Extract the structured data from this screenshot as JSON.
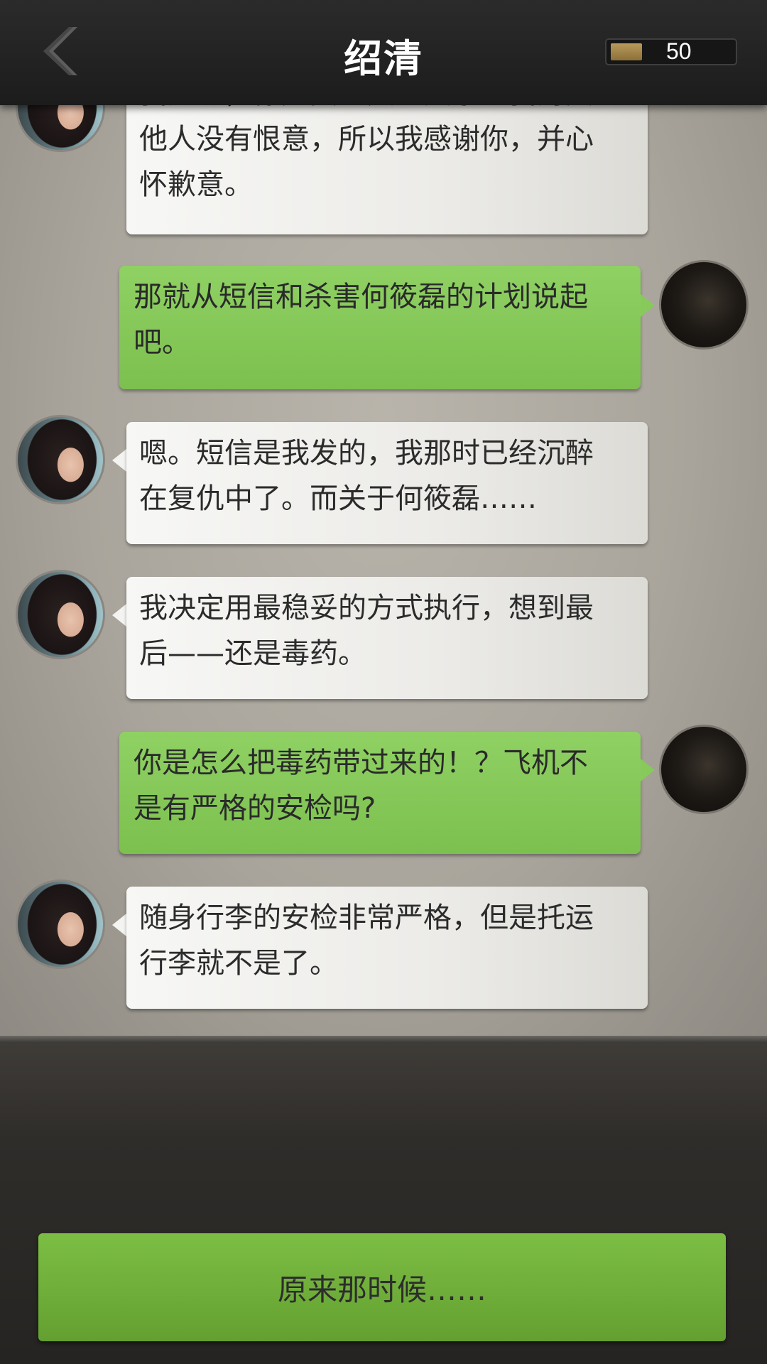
{
  "header": {
    "title": "绍清",
    "coin_count": "50"
  },
  "messages": [
    {
      "side": "left",
      "speaker": "绍清",
      "text_lines": [
        "我知道，你是真的关心大家。我对其",
        "他人没有恨意，所以我感谢你，并心",
        "怀歉意。"
      ]
    },
    {
      "side": "right",
      "speaker": "player",
      "text_lines": [
        "那就从短信和杀害何筱磊的计划说起",
        "吧。"
      ]
    },
    {
      "side": "left",
      "speaker": "绍清",
      "text_lines": [
        "嗯。短信是我发的，我那时已经沉醉",
        "在复仇中了。而关于何筱磊……"
      ]
    },
    {
      "side": "left",
      "speaker": "绍清",
      "text_lines": [
        "我决定用最稳妥的方式执行，想到最",
        "后——还是毒药。"
      ]
    },
    {
      "side": "right",
      "speaker": "player",
      "text_lines": [
        "你是怎么把毒药带过来的！？飞机不",
        "是有严格的安检吗?"
      ]
    },
    {
      "side": "left",
      "speaker": "绍清",
      "text_lines": [
        "随身行李的安检非常严格，但是托运",
        "行李就不是了。"
      ]
    }
  ],
  "reply": {
    "label": "原来那时候……"
  }
}
